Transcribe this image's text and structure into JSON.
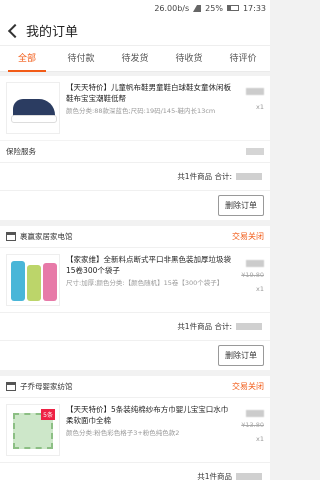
{
  "status_bar": {
    "speed": "26.00b/s",
    "battery": "25%",
    "time": "17:33"
  },
  "header": {
    "title": "我的订单"
  },
  "tabs": [
    {
      "label": "全部"
    },
    {
      "label": "待付款"
    },
    {
      "label": "待发货"
    },
    {
      "label": "待收货"
    },
    {
      "label": "待评价"
    }
  ],
  "orders": [
    {
      "shop": "",
      "status": "",
      "item": {
        "title": "【天天特价】儿童帆布鞋男童鞋白球鞋女童休闲板鞋布宝宝潮鞋低帮",
        "spec": "颜色分类:88款深蓝色;尺码:19码/145-鞋内长13cm",
        "qty": "x1"
      },
      "service_label": "保险服务",
      "summary": "共1件商品  合计:",
      "action": "删除订单"
    },
    {
      "shop": "裹赢家居家电馆",
      "status": "交易关闭",
      "item": {
        "title": "【家家维】全新料点断式平口非黑色装加厚垃圾袋15卷300个袋子",
        "spec": "尺寸:加厚;颜色分类:【颜色随机】15卷【300个袋子】",
        "orig_price": "¥19.80",
        "qty": "x1"
      },
      "summary": "共1件商品  合计:",
      "action": "删除订单"
    },
    {
      "shop": "子乔母婴家纺馆",
      "status": "交易关闭",
      "item": {
        "title": "【天天特价】5条装纯棉纱布方巾婴儿宝宝口水巾柔软面巾全棉",
        "spec": "颜色分类:粉色彩色格子3+粉色纯色款2",
        "badge": "5条",
        "orig_price": "¥13.80",
        "qty": "x1"
      },
      "summary": "共1件商品",
      "action": ""
    }
  ]
}
